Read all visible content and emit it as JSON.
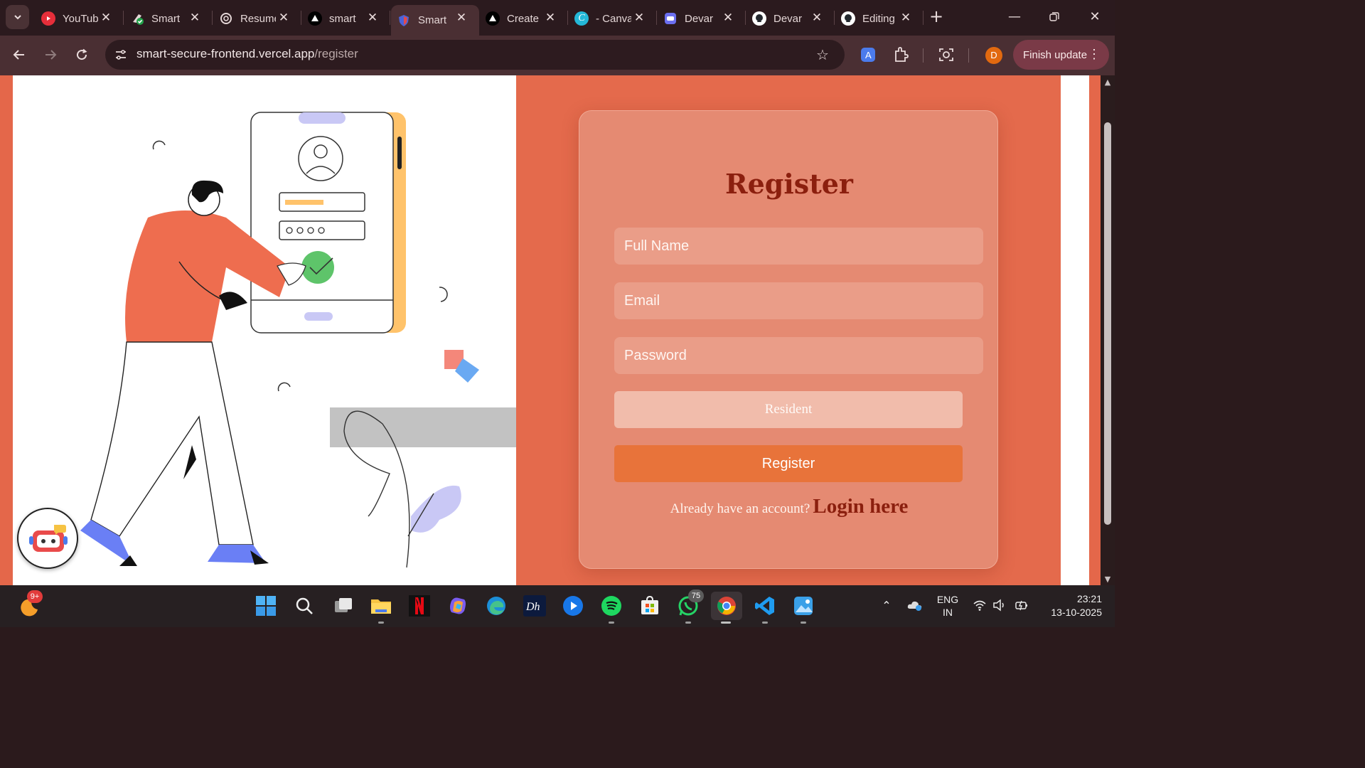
{
  "browser": {
    "tabs": [
      {
        "title": "YouTube",
        "favicon": "youtube-icon",
        "color": "#e62e3a"
      },
      {
        "title": "Smart",
        "favicon": "check-badge-icon",
        "color": "#22a34a"
      },
      {
        "title": "Resume",
        "favicon": "openai-icon",
        "color": "#e4d6d6"
      },
      {
        "title": "smart",
        "favicon": "triangle-icon",
        "color": "#ffffff"
      },
      {
        "title": "Smart",
        "favicon": "shield-icon",
        "color": "#4b63d8",
        "active": true
      },
      {
        "title": "Create",
        "favicon": "triangle-icon",
        "color": "#ffffff"
      },
      {
        "title": "- Canva",
        "favicon": "canva-icon",
        "color": "#24b8d8"
      },
      {
        "title": "Devar",
        "favicon": "app-icon",
        "color": "#6b6ff0"
      },
      {
        "title": "Devar",
        "favicon": "github-icon",
        "color": "#ffffff"
      },
      {
        "title": "Editing",
        "favicon": "github-icon",
        "color": "#ffffff"
      }
    ],
    "url_host": "smart-secure-frontend.vercel.app",
    "url_path": "/register",
    "profile_initial": "D",
    "finish_update_label": "Finish update"
  },
  "page": {
    "title": "Register",
    "fields": {
      "full_name_placeholder": "Full Name",
      "email_placeholder": "Email",
      "password_placeholder": "Password"
    },
    "role_select_value": "Resident",
    "register_button": "Register",
    "login_prompt": "Already have an account?",
    "login_link": "Login here",
    "colors": {
      "page_bg": "#e4674a",
      "card_bg": "#e58a72",
      "title": "#8b1f0e",
      "button": "#e8733a"
    }
  },
  "taskbar": {
    "notification_badge": "9+",
    "whatsapp_badge": "75",
    "language_line1": "ENG",
    "language_line2": "IN",
    "time": "23:21",
    "date": "13-10-2025"
  }
}
